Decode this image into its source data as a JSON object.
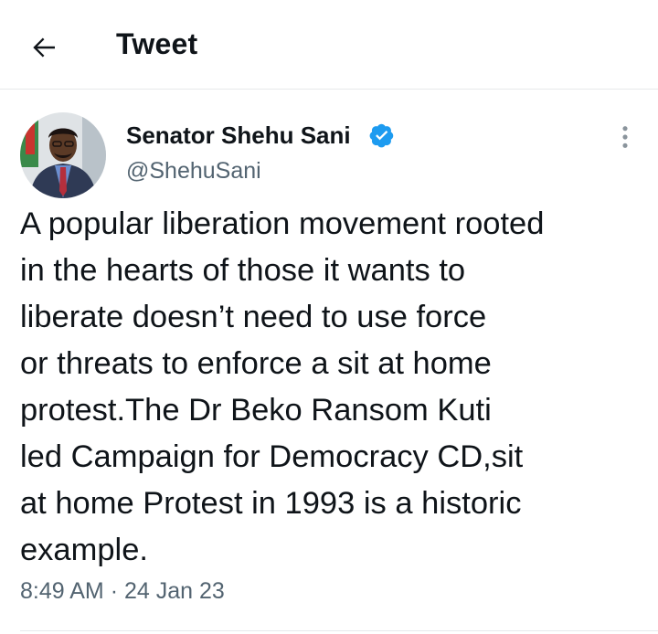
{
  "header": {
    "title": "Tweet",
    "back_icon": "arrow-left-icon"
  },
  "tweet": {
    "author_name": "Senator Shehu Sani",
    "handle": "@ShehuSani",
    "verified_icon": "verified-badge-icon",
    "more_icon": "vertical-ellipsis-icon",
    "text_lines": [
      "A popular liberation movement rooted",
      "in the hearts of those it wants to",
      "liberate doesn’t need to use force",
      "or threats to enforce a sit at home",
      "protest.The Dr Beko Ransom Kuti",
      "led Campaign for Democracy CD,sit",
      "at home Protest in 1993 is a historic",
      "example."
    ],
    "time": "8:49 AM",
    "separator": "·",
    "date": "24 Jan 23"
  },
  "colors": {
    "text_primary": "#0f1419",
    "text_secondary": "#536471",
    "verified_blue": "#1d9bf0",
    "divider": "#e6e9eb"
  }
}
